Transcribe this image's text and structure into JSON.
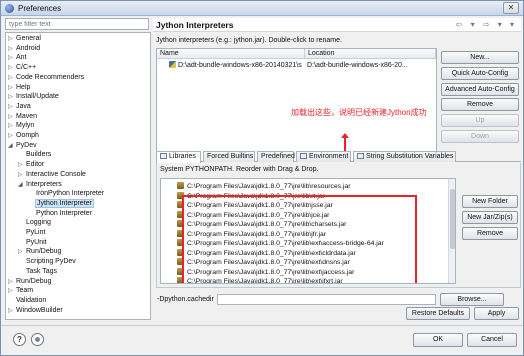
{
  "window": {
    "title": "Preferences",
    "close_glyph": "✕"
  },
  "filter": {
    "placeholder": "type filter text"
  },
  "tree": [
    {
      "label": "General",
      "indent": 0,
      "arrow": "▷"
    },
    {
      "label": "Android",
      "indent": 0,
      "arrow": "▷"
    },
    {
      "label": "Ant",
      "indent": 0,
      "arrow": "▷"
    },
    {
      "label": "C/C++",
      "indent": 0,
      "arrow": "▷"
    },
    {
      "label": "Code Recommenders",
      "indent": 0,
      "arrow": "▷"
    },
    {
      "label": "Help",
      "indent": 0,
      "arrow": "▷"
    },
    {
      "label": "Install/Update",
      "indent": 0,
      "arrow": "▷"
    },
    {
      "label": "Java",
      "indent": 0,
      "arrow": "▷"
    },
    {
      "label": "Maven",
      "indent": 0,
      "arrow": "▷"
    },
    {
      "label": "Mylyn",
      "indent": 0,
      "arrow": "▷"
    },
    {
      "label": "Oomph",
      "indent": 0,
      "arrow": "▷"
    },
    {
      "label": "PyDev",
      "indent": 0,
      "arrow": "◢"
    },
    {
      "label": "Builders",
      "indent": 1,
      "arrow": ""
    },
    {
      "label": "Editor",
      "indent": 1,
      "arrow": "▷"
    },
    {
      "label": "Interactive Console",
      "indent": 1,
      "arrow": "▷"
    },
    {
      "label": "Interpreters",
      "indent": 1,
      "arrow": "◢"
    },
    {
      "label": "IronPython Interpreter",
      "indent": 2,
      "arrow": ""
    },
    {
      "label": "Jython Interpreter",
      "indent": 2,
      "arrow": "",
      "selected": true
    },
    {
      "label": "Python Interpreter",
      "indent": 2,
      "arrow": ""
    },
    {
      "label": "Logging",
      "indent": 1,
      "arrow": ""
    },
    {
      "label": "PyLint",
      "indent": 1,
      "arrow": ""
    },
    {
      "label": "PyUnit",
      "indent": 1,
      "arrow": ""
    },
    {
      "label": "Run/Debug",
      "indent": 1,
      "arrow": "▷"
    },
    {
      "label": "Scripting PyDev",
      "indent": 1,
      "arrow": ""
    },
    {
      "label": "Task Tags",
      "indent": 1,
      "arrow": ""
    },
    {
      "label": "Run/Debug",
      "indent": 0,
      "arrow": "▷"
    },
    {
      "label": "Team",
      "indent": 0,
      "arrow": "▷"
    },
    {
      "label": "Validation",
      "indent": 0,
      "arrow": ""
    },
    {
      "label": "WindowBuilder",
      "indent": 0,
      "arrow": "▷"
    }
  ],
  "page": {
    "title": "Jython Interpreters",
    "nav_arrows": "⇦ ▾ ⇨ ▾ ▾",
    "description": "Jython interpreters (e.g.: jython.jar).  Double-click to rename."
  },
  "interpreters_table": {
    "col_name": "Name",
    "col_location": "Location",
    "row_name": "D:\\adt-bundle-windows-x86-20140321\\s",
    "row_location": "D:\\adt-bundle-windows-x86-20..."
  },
  "side_buttons": {
    "new": "New...",
    "quick_auto_config": "Quick Auto-Config",
    "advanced_auto_config": "Advanced Auto-Config",
    "remove": "Remove",
    "up": "Up",
    "down": "Down"
  },
  "annotation": "加载出这些，说明已经新建Jython成功",
  "tabs": {
    "libraries": "Libraries",
    "forced_builtins": "Forced Builtins",
    "predefined": "Predefined",
    "environment": "Environment",
    "string_substitution": "String Substitution Variables"
  },
  "libraries": {
    "description": "System PYTHONPATH.   Reorder with Drag & Drop.",
    "items": [
      "C:\\Program Files\\Java\\jdk1.8.0_77\\jre\\lib\\resources.jar",
      "C:\\Program Files\\Java\\jdk1.8.0_77\\jre\\lib\\rt.jar",
      "C:\\Program Files\\Java\\jdk1.8.0_77\\jre\\lib\\jsse.jar",
      "C:\\Program Files\\Java\\jdk1.8.0_77\\jre\\lib\\jce.jar",
      "C:\\Program Files\\Java\\jdk1.8.0_77\\jre\\lib\\charsets.jar",
      "C:\\Program Files\\Java\\jdk1.8.0_77\\jre\\lib\\jfr.jar",
      "C:\\Program Files\\Java\\jdk1.8.0_77\\jre\\lib\\ext\\access-bridge-64.jar",
      "C:\\Program Files\\Java\\jdk1.8.0_77\\jre\\lib\\ext\\cldrdata.jar",
      "C:\\Program Files\\Java\\jdk1.8.0_77\\jre\\lib\\ext\\dnsns.jar",
      "C:\\Program Files\\Java\\jdk1.8.0_77\\jre\\lib\\ext\\jaccess.jar",
      "C:\\Program Files\\Java\\jdk1.8.0_77\\jre\\lib\\ext\\jfxrt.jar"
    ],
    "new_folder": "New Folder",
    "new_jar": "New Jar/Zip(s)",
    "remove": "Remove"
  },
  "cachedir": {
    "label": "-Dpython.cachedir",
    "browse": "Browse..."
  },
  "footer": {
    "restore_defaults": "Restore Defaults",
    "apply": "Apply",
    "ok": "OK",
    "cancel": "Cancel",
    "help_glyph": "?"
  },
  "colors": {
    "annotation_red": "#e8242a",
    "selection": "#cde4f7"
  }
}
